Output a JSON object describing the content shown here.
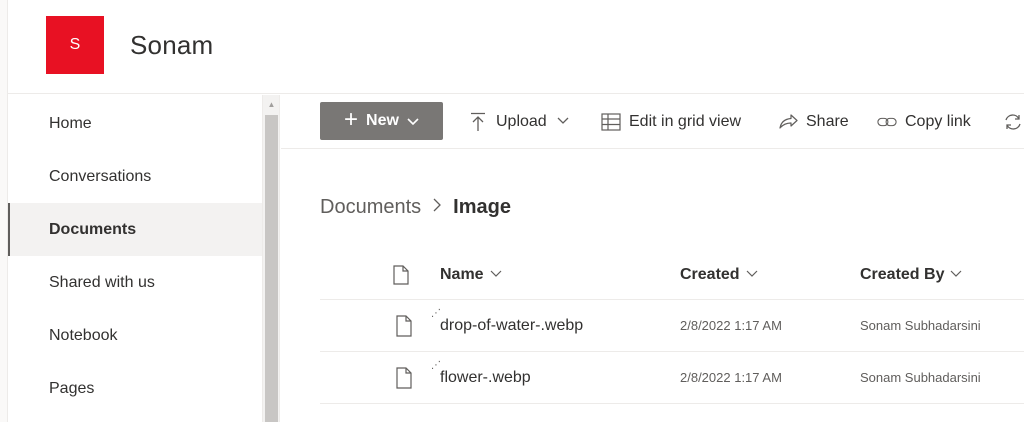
{
  "site": {
    "logo_letter": "S",
    "title": "Sonam"
  },
  "nav": {
    "items": [
      {
        "label": "Home"
      },
      {
        "label": "Conversations"
      },
      {
        "label": "Documents"
      },
      {
        "label": "Shared with us"
      },
      {
        "label": "Notebook"
      },
      {
        "label": "Pages"
      }
    ],
    "active": "Documents"
  },
  "commands": {
    "new": "New",
    "upload": "Upload",
    "edit_grid": "Edit in grid view",
    "share": "Share",
    "copy_link": "Copy link"
  },
  "breadcrumb": {
    "parent": "Documents",
    "current": "Image"
  },
  "table": {
    "headers": {
      "name": "Name",
      "created": "Created",
      "created_by": "Created By"
    },
    "rows": [
      {
        "name": "drop-of-water-.webp",
        "created": "2/8/2022 1:17 AM",
        "created_by": "Sonam Subhadarsini"
      },
      {
        "name": "flower-.webp",
        "created": "2/8/2022 1:17 AM",
        "created_by": "Sonam Subhadarsini"
      }
    ]
  },
  "colors": {
    "logo": "#e81123",
    "new_button": "#797775",
    "active_nav": "#f3f2f1"
  },
  "icons": {
    "new": "plus-icon",
    "upload": "upload-arrow-icon",
    "edit_grid": "grid-icon",
    "share": "share-icon",
    "copy_link": "link-icon",
    "file": "file-icon"
  }
}
